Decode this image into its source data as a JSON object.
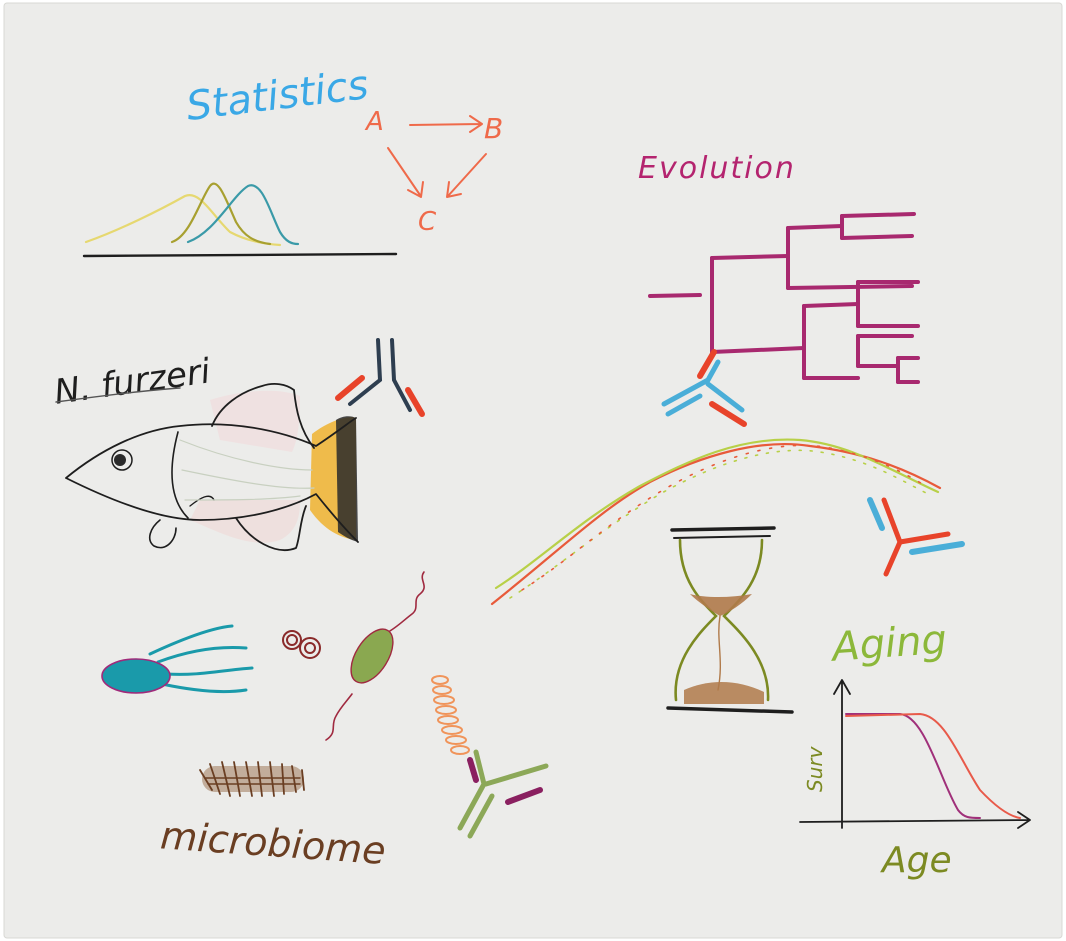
{
  "labels": {
    "statistics": "Statistics",
    "evolution": "Evolution",
    "species": "N. furzeri",
    "aging": "Aging",
    "microbiome": "microbiome",
    "survival_axis": "Surv",
    "age_axis": "Age",
    "graph_a": "A",
    "graph_b": "B",
    "graph_c": "C"
  },
  "colors": {
    "paper": "#ececea",
    "statistics": "#3aa8e6",
    "graph": "#ef6a4a",
    "evolution": "#b4246f",
    "tree": "#a8296f",
    "aging": "#8cb83a",
    "hourglass": "#7c8a22",
    "sand": "#b07a4a",
    "microbiome": "#6a3e22",
    "fish_line": "#1e1e1e",
    "fish_tail_orange": "#f0b63a",
    "fish_tail_black": "#2a2a2a",
    "antibody_red": "#e8432a",
    "antibody_blue": "#4aaed8",
    "antibody_dark": "#2e3e50",
    "antibody_green": "#8ca858",
    "antibody_purple": "#8a2060",
    "dna_red": "#e85a3a",
    "dna_green": "#b8d048",
    "bacterium_teal": "#1a9aaa",
    "bacterium_green": "#8aa850",
    "coccus_red": "#8a2a2a",
    "spiral_orange": "#f0945a",
    "curve_yellow": "#e6d870",
    "curve_olive": "#a8a030",
    "curve_teal": "#3a9aa8",
    "surv_red": "#e85a4a",
    "surv_purple": "#a0307a",
    "axis": "#1e1e1e"
  },
  "icons": [
    "distribution-curves-icon",
    "causal-graph-icon",
    "phylogenetic-tree-icon",
    "antibody-icon",
    "dna-helix-icon",
    "fish-icon",
    "hourglass-icon",
    "survival-plot-icon",
    "flagellated-bacterium-icon",
    "coccus-bacteria-icon",
    "spirillum-bacterium-icon",
    "ciliated-bacterium-icon",
    "spiral-chain-bacterium-icon"
  ]
}
